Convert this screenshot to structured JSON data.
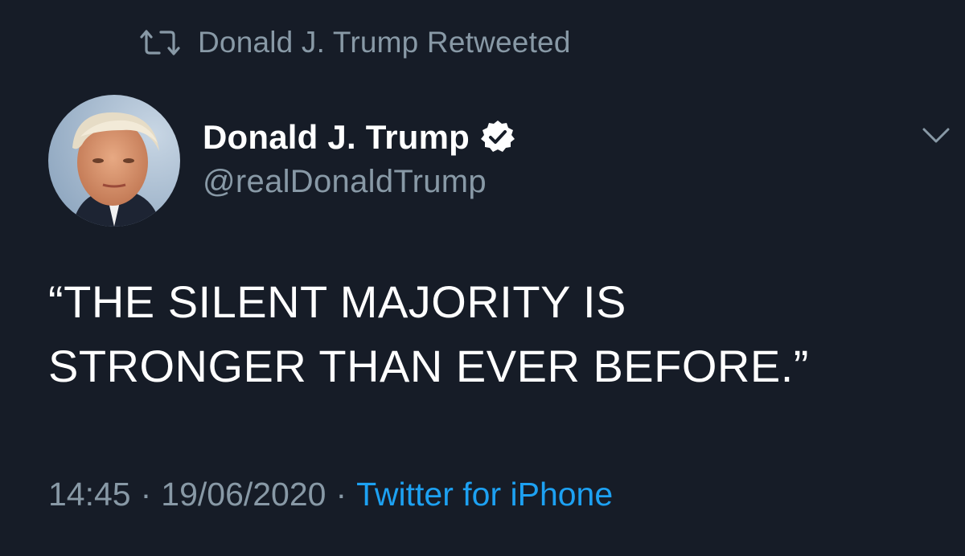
{
  "retweet": {
    "icon": "retweet-icon",
    "text": "Donald J. Trump Retweeted"
  },
  "author": {
    "avatar": "avatar-photo",
    "name": "Donald J. Trump",
    "verified_icon": "verified-badge-icon",
    "handle": "@realDonaldTrump"
  },
  "menu": {
    "icon": "chevron-down-icon"
  },
  "tweet": {
    "line1": "“THE SILENT MAJORITY IS",
    "line2": "STRONGER THAN EVER BEFORE.”"
  },
  "meta": {
    "time": "14:45",
    "separator": "·",
    "date": "19/06/2020",
    "source": "Twitter for iPhone"
  },
  "colors": {
    "background": "#161c27",
    "secondary_text": "#8899a6",
    "primary_text": "#ffffff",
    "link": "#1da1f2"
  }
}
